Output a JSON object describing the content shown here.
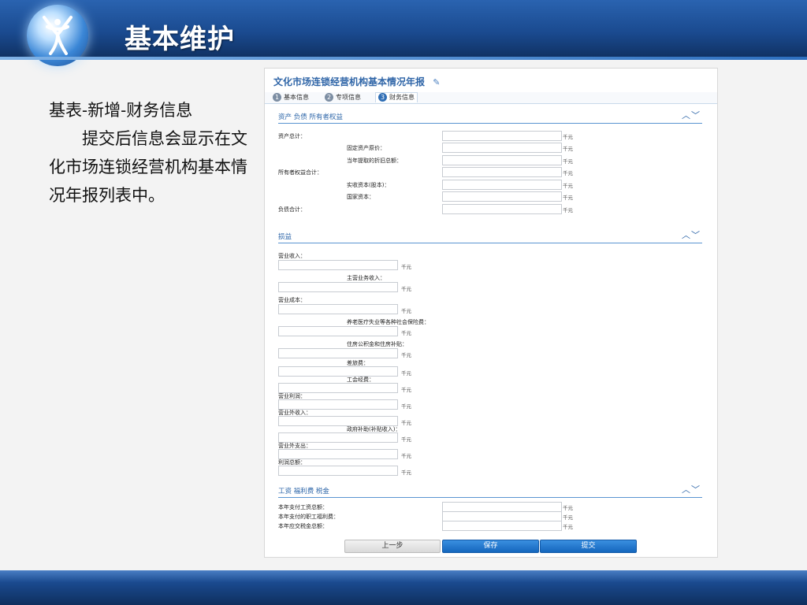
{
  "slide": {
    "title": "基本维护",
    "explain_line1": "基表-新增-财务信息",
    "explain_line2": "提交后信息会显示在文化市场连锁经营机构基本情况年报列表中。"
  },
  "form": {
    "title": "文化市场连锁经营机构基本情况年报",
    "edit_icon": "edit-icon",
    "tabs": [
      {
        "num": "1",
        "label": "基本信息"
      },
      {
        "num": "2",
        "label": "专项信息"
      },
      {
        "num": "3",
        "label": "财务信息"
      }
    ],
    "unit": "千元",
    "chevron_icon": "︿﹀",
    "sections": {
      "assets": {
        "title": "资产 负债 所有者权益",
        "fields": [
          {
            "label": "资产总计：",
            "value": ""
          },
          {
            "label": "固定资产原价：",
            "value": ""
          },
          {
            "label": "当年提取的折旧总额：",
            "value": ""
          },
          {
            "label": "所有者权益合计：",
            "value": ""
          },
          {
            "label": "实收资本(股本)：",
            "value": ""
          },
          {
            "label": "国家资本：",
            "value": ""
          },
          {
            "label": "负债合计：",
            "value": ""
          }
        ]
      },
      "pl": {
        "title": "损益",
        "fields": [
          {
            "label": "营业收入：",
            "value": ""
          },
          {
            "label": "主营业务收入：",
            "value": ""
          },
          {
            "label": "营业成本：",
            "value": ""
          },
          {
            "label": "养老医疗失业等各种社会保险费：",
            "value": ""
          },
          {
            "label": "住房公积金和住房补贴：",
            "value": ""
          },
          {
            "label": "差旅费：",
            "value": ""
          },
          {
            "label": "工会经费：",
            "value": ""
          },
          {
            "label": "营业利润：",
            "value": ""
          },
          {
            "label": "营业外收入：",
            "value": ""
          },
          {
            "label": "政府补助(补贴收入)：",
            "value": ""
          },
          {
            "label": "营业外支出：",
            "value": ""
          },
          {
            "label": "利润总额：",
            "value": ""
          }
        ]
      },
      "wages": {
        "title": "工资 福利费 税金",
        "fields": [
          {
            "label": "本年支付工资总额：",
            "value": ""
          },
          {
            "label": "本年支付的职工福利费：",
            "value": ""
          },
          {
            "label": "本年应交税金总额：",
            "value": ""
          }
        ]
      }
    },
    "buttons": {
      "prev": "上一步",
      "save": "保存",
      "submit": "提交"
    }
  },
  "colors": {
    "header_blue": "#1a4a8f",
    "accent_blue": "#2c65a8",
    "primary_button": "#1466bd"
  }
}
